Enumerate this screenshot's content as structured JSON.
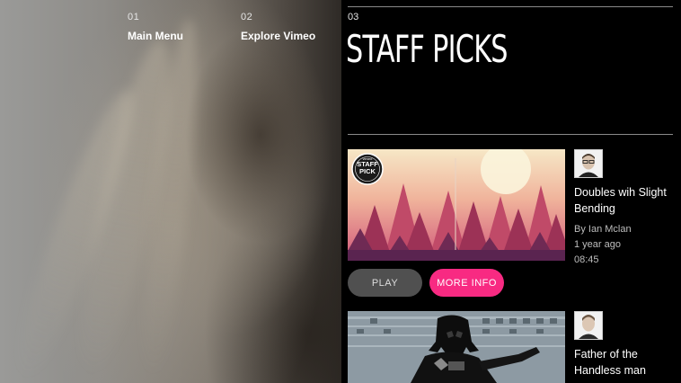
{
  "nav": {
    "items": [
      {
        "num": "01",
        "label": "Main Menu"
      },
      {
        "num": "02",
        "label": "Explore Vimeo"
      }
    ]
  },
  "section": {
    "num": "03",
    "title": "STAFF PICKS"
  },
  "videos": [
    {
      "badge_top": "vimeo",
      "badge_main": "STAFF PICK",
      "title": "Doubles wih Slight Bending",
      "author": "By Ian Mclan",
      "age": "1 year ago",
      "duration": "08:45"
    },
    {
      "title": "Father of the Handless man"
    }
  ],
  "buttons": {
    "play": "PLAY",
    "more_info": "MORE INFO"
  },
  "colors": {
    "accent": "#f82a82",
    "play_button": "#505050",
    "background": "#000000"
  },
  "icons": [
    "staff-pick-badge-icon",
    "author-avatar-icon"
  ]
}
